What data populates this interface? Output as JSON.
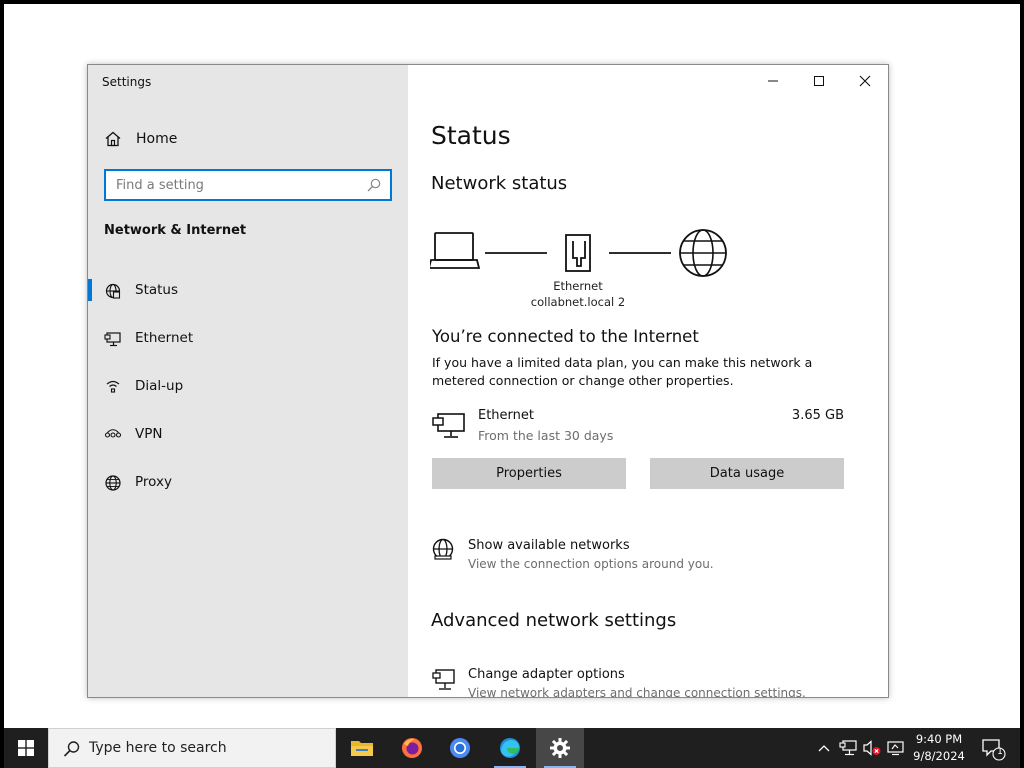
{
  "window": {
    "title": "Settings",
    "controls": {
      "minimize": "minimize",
      "maximize": "maximize",
      "close": "close"
    }
  },
  "sidebar": {
    "home_label": "Home",
    "search_placeholder": "Find a setting",
    "section_title": "Network & Internet",
    "items": [
      {
        "label": "Status",
        "icon": "globe-status-icon",
        "selected": true
      },
      {
        "label": "Ethernet",
        "icon": "ethernet-icon",
        "selected": false
      },
      {
        "label": "Dial-up",
        "icon": "dial-up-icon",
        "selected": false
      },
      {
        "label": "VPN",
        "icon": "vpn-icon",
        "selected": false
      },
      {
        "label": "Proxy",
        "icon": "globe-icon",
        "selected": false
      }
    ]
  },
  "main": {
    "title": "Status",
    "network_status_heading": "Network status",
    "diagram": {
      "adapter_label": "Ethernet",
      "network_name": "collabnet.local 2"
    },
    "connected_title": "You’re connected to the Internet",
    "connected_desc": "If you have a limited data plan, you can make this network a metered connection or change other properties.",
    "ethernet": {
      "name": "Ethernet",
      "period": "From the last 30 days",
      "usage": "3.65 GB"
    },
    "buttons": {
      "properties": "Properties",
      "data_usage": "Data usage"
    },
    "show_networks": {
      "title": "Show available networks",
      "desc": "View the connection options around you."
    },
    "advanced_heading": "Advanced network settings",
    "adapter_options": {
      "title": "Change adapter options",
      "desc": "View network adapters and change connection settings."
    }
  },
  "taskbar": {
    "search_placeholder": "Type here to search",
    "apps": [
      "file-explorer",
      "firefox",
      "chromium",
      "edge",
      "settings"
    ],
    "clock": {
      "time": "9:40 PM",
      "date": "9/8/2024"
    },
    "notification_count": "1",
    "accent": "#0078d7"
  }
}
